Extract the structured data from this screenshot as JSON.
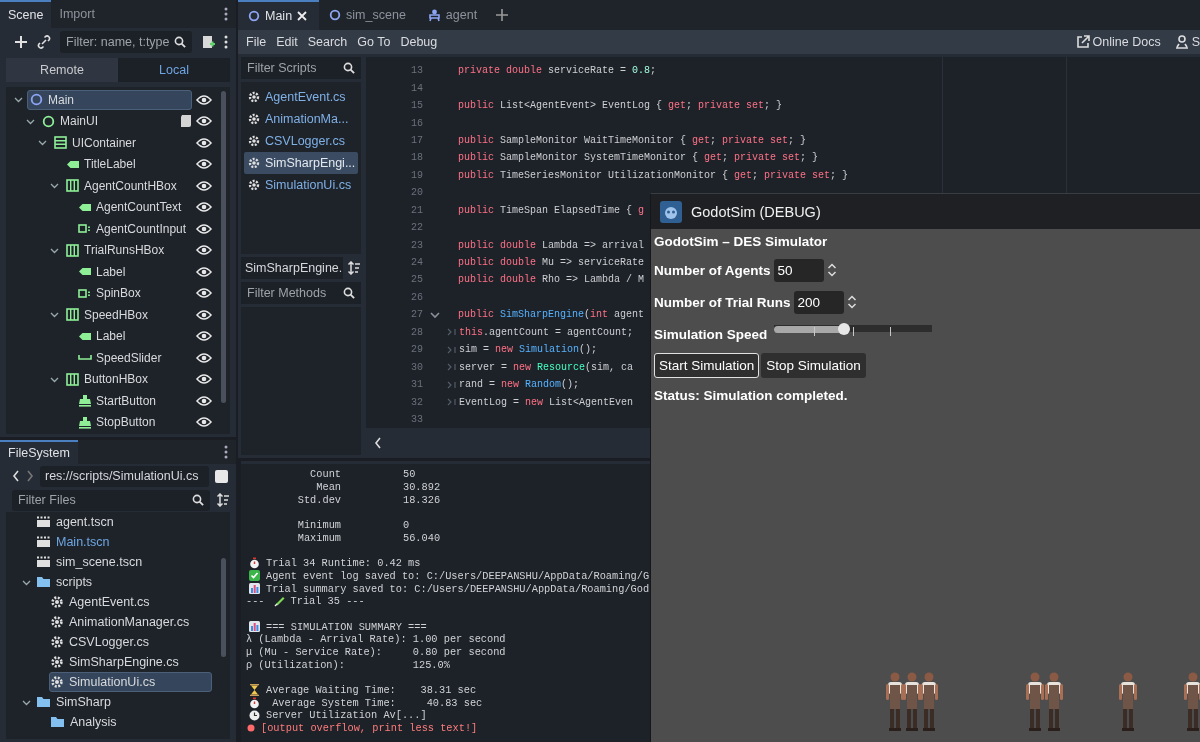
{
  "editor_tabs": [
    {
      "label": "Main",
      "kind": "scene",
      "selected": true
    },
    {
      "label": "sim_scene",
      "kind": "scene",
      "selected": false
    },
    {
      "label": "agent",
      "kind": "agent",
      "selected": false
    }
  ],
  "scene_dock": {
    "tabs": [
      {
        "label": "Scene",
        "selected": true
      },
      {
        "label": "Import",
        "selected": false
      }
    ],
    "filter": {
      "placeholder": "Filter: name, t:type"
    },
    "modes": [
      {
        "label": "Remote",
        "selected": false
      },
      {
        "label": "Local",
        "selected": true
      }
    ],
    "tree": [
      {
        "name": "Main",
        "kind": "node2d",
        "selected": true,
        "visible": true,
        "script": false,
        "children": [
          {
            "name": "MainUI",
            "kind": "control",
            "selected": false,
            "visible": true,
            "script": true,
            "children": [
              {
                "name": "UIContainer",
                "kind": "vbox",
                "selected": false,
                "visible": true,
                "script": false,
                "children": [
                  {
                    "name": "TitleLabel",
                    "kind": "label",
                    "selected": false,
                    "visible": true,
                    "script": false
                  },
                  {
                    "name": "AgentCountHBox",
                    "kind": "hbox",
                    "selected": false,
                    "visible": true,
                    "script": false,
                    "children": [
                      {
                        "name": "AgentCountText",
                        "kind": "label",
                        "selected": false,
                        "visible": true,
                        "script": false
                      },
                      {
                        "name": "AgentCountInput",
                        "kind": "spinbox",
                        "selected": false,
                        "visible": true,
                        "script": false
                      }
                    ]
                  },
                  {
                    "name": "TrialRunsHBox",
                    "kind": "hbox",
                    "selected": false,
                    "visible": true,
                    "script": false,
                    "children": [
                      {
                        "name": "Label",
                        "kind": "label",
                        "selected": false,
                        "visible": true,
                        "script": false
                      },
                      {
                        "name": "SpinBox",
                        "kind": "spinbox",
                        "selected": false,
                        "visible": true,
                        "script": false
                      }
                    ]
                  },
                  {
                    "name": "SpeedHBox",
                    "kind": "hbox",
                    "selected": false,
                    "visible": true,
                    "script": false,
                    "children": [
                      {
                        "name": "Label",
                        "kind": "label",
                        "selected": false,
                        "visible": true,
                        "script": false
                      },
                      {
                        "name": "SpeedSlider",
                        "kind": "slider",
                        "selected": false,
                        "visible": true,
                        "script": false
                      }
                    ]
                  },
                  {
                    "name": "ButtonHBox",
                    "kind": "hbox",
                    "selected": false,
                    "visible": true,
                    "script": false,
                    "children": [
                      {
                        "name": "StartButton",
                        "kind": "button",
                        "selected": false,
                        "visible": true,
                        "script": false
                      },
                      {
                        "name": "StopButton",
                        "kind": "button",
                        "selected": false,
                        "visible": true,
                        "script": false
                      }
                    ]
                  }
                ]
              }
            ]
          }
        ]
      }
    ]
  },
  "filesystem_dock": {
    "title": "FileSystem",
    "path": "res://scripts/SimulationUi.cs",
    "filter": {
      "placeholder": "Filter Files"
    },
    "tree": [
      {
        "name": "agent.tscn",
        "kind": "scene",
        "selected": false,
        "current": false
      },
      {
        "name": "Main.tscn",
        "kind": "scene",
        "selected": false,
        "current": true
      },
      {
        "name": "sim_scene.tscn",
        "kind": "scene",
        "selected": false,
        "current": false
      },
      {
        "name": "scripts",
        "kind": "folder",
        "selected": false,
        "current": false,
        "children": [
          {
            "name": "AgentEvent.cs",
            "kind": "script",
            "selected": false,
            "current": false
          },
          {
            "name": "AnimationManager.cs",
            "kind": "script",
            "selected": false,
            "current": false
          },
          {
            "name": "CSVLogger.cs",
            "kind": "script",
            "selected": false,
            "current": false
          },
          {
            "name": "SimSharpEngine.cs",
            "kind": "script",
            "selected": false,
            "current": false
          },
          {
            "name": "SimulationUi.cs",
            "kind": "script",
            "selected": true,
            "current": false
          }
        ]
      },
      {
        "name": "SimSharp",
        "kind": "folder",
        "selected": false,
        "current": false,
        "children": [
          {
            "name": "Analysis",
            "kind": "folder",
            "selected": false,
            "current": false
          }
        ]
      }
    ]
  },
  "menu": [
    "File",
    "Edit",
    "Search",
    "Go To",
    "Debug"
  ],
  "toolbar_right": [
    {
      "label": "Online Docs",
      "kind": "docs"
    },
    {
      "label": "S",
      "kind": "help"
    }
  ],
  "script_panel": {
    "filter": {
      "placeholder": "Filter Scripts"
    },
    "scripts": [
      {
        "name": "AgentEvent.cs",
        "selected": false
      },
      {
        "name": "AnimationMa...",
        "selected": false
      },
      {
        "name": "CSVLogger.cs",
        "selected": false
      },
      {
        "name": "SimSharpEngi...",
        "selected": true
      },
      {
        "name": "SimulationUi.cs",
        "selected": false
      }
    ],
    "current_script": "SimSharpEngine.",
    "method_filter": {
      "placeholder": "Filter Methods"
    }
  },
  "code": {
    "lines": [
      {
        "n": "13",
        "fold": false,
        "tab_marker": false,
        "tokens": [
          {
            "t": "private double",
            "kind": "kw"
          },
          {
            "t": " serviceRate = ",
            "kind": "id"
          },
          {
            "t": "0.8",
            "kind": "num"
          },
          {
            "t": ";",
            "kind": "id"
          }
        ]
      },
      {
        "n": "14",
        "fold": false,
        "tab_marker": false
      },
      {
        "n": "15",
        "fold": false,
        "tab_marker": false,
        "tokens": [
          {
            "t": "public",
            "kind": "kw"
          },
          {
            "t": " List<AgentEvent> EventLog { ",
            "kind": "id"
          },
          {
            "t": "get",
            "kind": "kw"
          },
          {
            "t": "; ",
            "kind": "id"
          },
          {
            "t": "private set",
            "kind": "kw"
          },
          {
            "t": "; }",
            "kind": "id"
          }
        ]
      },
      {
        "n": "16",
        "fold": false,
        "tab_marker": false
      },
      {
        "n": "17",
        "fold": false,
        "tab_marker": false,
        "tokens": [
          {
            "t": "public",
            "kind": "kw"
          },
          {
            "t": " SampleMonitor WaitTimeMonitor { ",
            "kind": "id"
          },
          {
            "t": "get",
            "kind": "kw"
          },
          {
            "t": "; ",
            "kind": "id"
          },
          {
            "t": "private set",
            "kind": "kw"
          },
          {
            "t": "; }",
            "kind": "id"
          }
        ]
      },
      {
        "n": "18",
        "fold": false,
        "tab_marker": false,
        "tokens": [
          {
            "t": "public",
            "kind": "kw"
          },
          {
            "t": " SampleMonitor SystemTimeMonitor { ",
            "kind": "id"
          },
          {
            "t": "get",
            "kind": "kw"
          },
          {
            "t": "; ",
            "kind": "id"
          },
          {
            "t": "private set",
            "kind": "kw"
          },
          {
            "t": "; }",
            "kind": "id"
          }
        ]
      },
      {
        "n": "19",
        "fold": false,
        "tab_marker": false,
        "tokens": [
          {
            "t": "public",
            "kind": "kw"
          },
          {
            "t": " TimeSeriesMonitor UtilizationMonitor { ",
            "kind": "id"
          },
          {
            "t": "get",
            "kind": "kw"
          },
          {
            "t": "; ",
            "kind": "id"
          },
          {
            "t": "private set",
            "kind": "kw"
          },
          {
            "t": "; }",
            "kind": "id"
          }
        ]
      },
      {
        "n": "20",
        "fold": false,
        "tab_marker": false
      },
      {
        "n": "21",
        "fold": false,
        "tab_marker": false,
        "tokens": [
          {
            "t": "public",
            "kind": "kw"
          },
          {
            "t": " TimeSpan ElapsedTime { ",
            "kind": "id"
          },
          {
            "t": "g",
            "kind": "kw"
          }
        ]
      },
      {
        "n": "22",
        "fold": false,
        "tab_marker": false
      },
      {
        "n": "23",
        "fold": false,
        "tab_marker": false,
        "tokens": [
          {
            "t": "public double",
            "kind": "kw"
          },
          {
            "t": " Lambda => arrival",
            "kind": "id"
          }
        ]
      },
      {
        "n": "24",
        "fold": false,
        "tab_marker": false,
        "tokens": [
          {
            "t": "public double",
            "kind": "kw"
          },
          {
            "t": " Mu => serviceRate",
            "kind": "id"
          }
        ]
      },
      {
        "n": "25",
        "fold": false,
        "tab_marker": false,
        "tokens": [
          {
            "t": "public double",
            "kind": "kw"
          },
          {
            "t": " Rho => Lambda / M",
            "kind": "id"
          }
        ]
      },
      {
        "n": "26",
        "fold": false,
        "tab_marker": false
      },
      {
        "n": "27",
        "fold": true,
        "tab_marker": false,
        "tokens": [
          {
            "t": "public ",
            "kind": "kw"
          },
          {
            "t": "SimSharpEngine",
            "kind": "fn"
          },
          {
            "t": "(",
            "kind": "id"
          },
          {
            "t": "int",
            "kind": "kw"
          },
          {
            "t": " agent",
            "kind": "id"
          }
        ]
      },
      {
        "n": "28",
        "fold": false,
        "tab_marker": true,
        "tokens": [
          {
            "t": "this",
            "kind": "kw"
          },
          {
            "t": ".agentCount = agentCount;",
            "kind": "id"
          }
        ]
      },
      {
        "n": "29",
        "fold": false,
        "tab_marker": true,
        "tokens": [
          {
            "t": "sim = ",
            "kind": "id"
          },
          {
            "t": "new ",
            "kind": "kw"
          },
          {
            "t": "Simulation",
            "kind": "fn"
          },
          {
            "t": "();",
            "kind": "id"
          }
        ]
      },
      {
        "n": "30",
        "fold": false,
        "tab_marker": true,
        "tokens": [
          {
            "t": "server = ",
            "kind": "id"
          },
          {
            "t": "new ",
            "kind": "kw"
          },
          {
            "t": "Resource",
            "kind": "cls"
          },
          {
            "t": "(sim, ca",
            "kind": "id"
          }
        ]
      },
      {
        "n": "31",
        "fold": false,
        "tab_marker": true,
        "tokens": [
          {
            "t": "rand = ",
            "kind": "id"
          },
          {
            "t": "new ",
            "kind": "kw"
          },
          {
            "t": "Random",
            "kind": "fn"
          },
          {
            "t": "();",
            "kind": "id"
          }
        ]
      },
      {
        "n": "32",
        "fold": false,
        "tab_marker": true,
        "tokens": [
          {
            "t": "EventLog = ",
            "kind": "id"
          },
          {
            "t": "new",
            "kind": "kw"
          },
          {
            "t": " List<AgentEven",
            "kind": "id"
          }
        ]
      },
      {
        "n": "33",
        "fold": false,
        "tab_marker": false
      }
    ]
  },
  "output": {
    "blocks": [
      [
        {
          "kind": "stat",
          "label": "Count",
          "value": "50"
        },
        {
          "kind": "stat",
          "label": "Mean",
          "value": "30.892"
        },
        {
          "kind": "stat",
          "label": "Std.dev",
          "value": "18.326"
        }
      ],
      [
        {
          "kind": "stat",
          "label": "Minimum",
          "value": "0"
        },
        {
          "kind": "stat",
          "label": "Maximum",
          "value": "56.040"
        }
      ],
      [
        {
          "kind": "timer",
          "text": "Trial 34 Runtime: 0.42 ms"
        },
        {
          "kind": "success",
          "text": "Agent event log saved to: C:/Users/DEEPANSHU/AppData/Roaming/G"
        },
        {
          "kind": "chart",
          "text": "Trial summary saved to: C:/Users/DEEPANSHU/AppData/Roaming/God"
        },
        {
          "kind": "trial",
          "prefix": "---",
          "text": "Trial 35 ---"
        }
      ],
      [
        {
          "kind": "chart",
          "text": "=== SIMULATION SUMMARY ==="
        },
        {
          "kind": "plain",
          "text": "λ (Lambda - Arrival Rate): 1.00 per second"
        },
        {
          "kind": "plain",
          "text": "μ (Mu - Service Rate):     0.80 per second"
        },
        {
          "kind": "plain",
          "text": "ρ (Utilization):           125.0%"
        }
      ],
      [
        {
          "kind": "wait",
          "text": "Average Waiting Time:    38.31 sec"
        },
        {
          "kind": "timer",
          "text": " Average System Time:     40.83 sec"
        },
        {
          "kind": "clock",
          "text": "Server Utilization Av[...]"
        },
        {
          "kind": "error",
          "text": "[output overflow, print less text!]"
        }
      ]
    ]
  },
  "game_window": {
    "title": "GodotSim (DEBUG)",
    "heading": "GodotSim – DES Simulator",
    "fields": [
      {
        "label": "Number of Agents",
        "value": "50"
      },
      {
        "label": "Number of Trial Runs",
        "value": "200"
      }
    ],
    "slider": {
      "label": "Simulation Speed",
      "level": 0.44
    },
    "buttons": [
      {
        "label": "Start Simulation",
        "focused": true
      },
      {
        "label": "Stop Simulation",
        "focused": false
      }
    ],
    "status": "Status: Simulation completed."
  }
}
